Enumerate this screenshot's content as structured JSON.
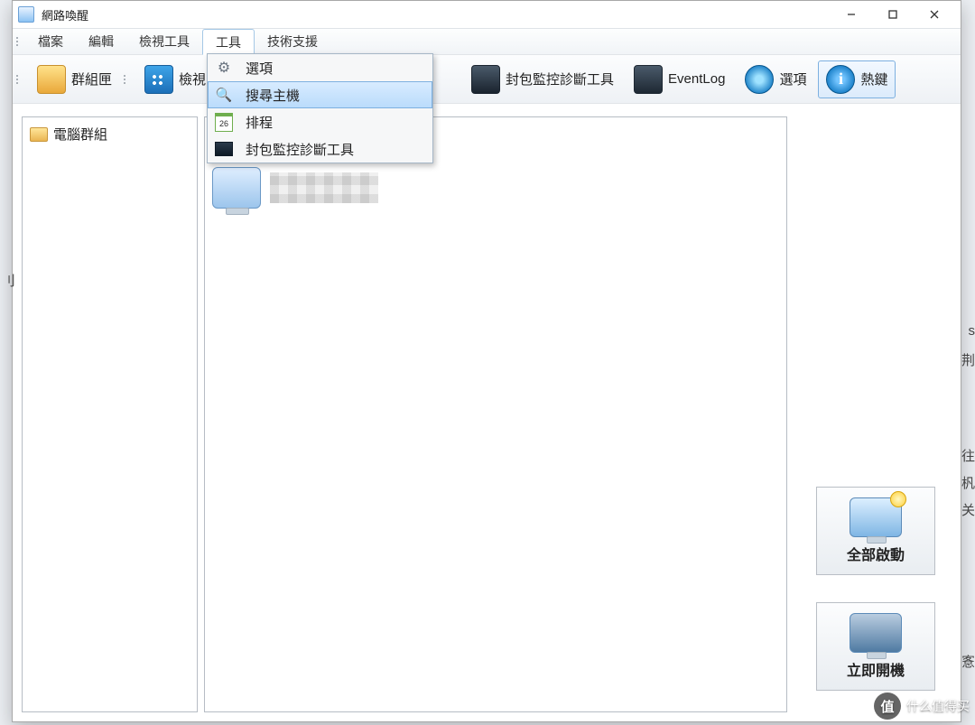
{
  "window": {
    "title": "網路喚醒"
  },
  "menubar": {
    "items": [
      "檔案",
      "編輯",
      "檢視工具",
      "工具",
      "技術支援"
    ],
    "open_index": 3
  },
  "toolbar": {
    "group_box": "群組匣",
    "view": "檢視",
    "packet_monitor": "封包監控診斷工具",
    "event_log": "EventLog",
    "options": "選項",
    "hotkeys": "熱鍵"
  },
  "dropdown": {
    "items": [
      {
        "icon": "gear",
        "label": "選項",
        "highlight": false
      },
      {
        "icon": "search",
        "label": "搜尋主機",
        "highlight": true
      },
      {
        "icon": "cal",
        "label": "排程",
        "cal_text": "26",
        "highlight": false
      },
      {
        "icon": "diag",
        "label": "封包監控診斷工具",
        "highlight": false
      }
    ]
  },
  "tree": {
    "root": "電腦群組"
  },
  "side_buttons": {
    "start_all": "全部啟動",
    "boot_now": "立即開機"
  },
  "edge": {
    "left_char": "刂",
    "right_chars": [
      "s",
      "荆",
      "往",
      "杋",
      "关",
      "愙"
    ]
  },
  "watermark": {
    "badge": "值",
    "text": "什么值得买"
  }
}
